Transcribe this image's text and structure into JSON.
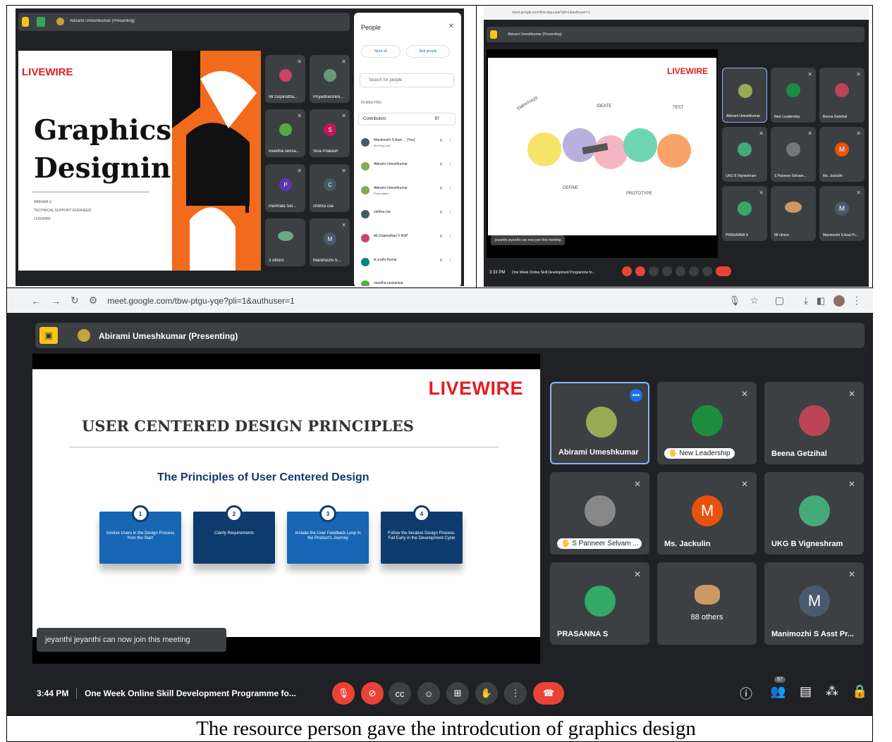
{
  "top_left": {
    "presenter": "Abirami Umeshkumar (Presenting)",
    "slide": {
      "brand": "LIVEWIRE",
      "title_line1": "Graphics",
      "title_line2": "Designing",
      "small1": "ABIRAMI U",
      "small2": "TECHNICAL SUPPORT ENGINEER",
      "small3": "LIVEWIRE"
    },
    "tiles": [
      "Mr.Gopinatha...",
      "Priyadharshini...",
      "nivedha ravisa...",
      "Siva Prakash",
      "Parimala Sel...",
      "chithra cse",
      "3 others",
      "Manimozhi S..."
    ],
    "tile_letters": [
      "S",
      "P",
      "C",
      "M"
    ],
    "people_panel": {
      "title": "People",
      "mute_all": "Mute all",
      "add_people": "Add people",
      "search_placeholder": "Search for people",
      "in_meeting": "IN MEETING",
      "contributors": "Contributors",
      "count": "97",
      "list": [
        {
          "name": "Manimozhi S Asst ... (You)",
          "sub": "Meeting host"
        },
        {
          "name": "Abirami Umeshkumar",
          "sub": ""
        },
        {
          "name": "Abirami Umeshkumar",
          "sub": "Presentation"
        },
        {
          "name": "chithra cse",
          "sub": ""
        },
        {
          "name": "Mr.Gopinathan V ASP",
          "sub": ""
        },
        {
          "name": "A.sruthi Kumar",
          "sub": ""
        },
        {
          "name": "nivedha ravisankar",
          "sub": ""
        }
      ]
    }
  },
  "top_right": {
    "url": "meet.google.com/tbw-ptgu-yqe?pli=1&authuser=1",
    "presenter": "Abirami Umeshkumar (Presenting)",
    "slide": {
      "brand": "LIVEWIRE",
      "labels": [
        "EMPATHIZE",
        "DEFINE",
        "IDEATE",
        "PROTOTYPE",
        "TEST"
      ]
    },
    "notice": "jeyanthi jeyanthi can now join this meeting",
    "tiles": [
      "Abirami Umeshkumar",
      "New Leadership",
      "Beena Getzihal",
      "UKG B Vigneshram",
      "S Panneer Selvam...",
      "Ms. Jackulin",
      "PRASANNA S",
      "88 others",
      "Manimozhi S Asst Pr..."
    ],
    "tile_letters": [
      "M",
      "M"
    ],
    "time": "3:33 PM",
    "meeting": "One Week Online Skill Development Programme fo..."
  },
  "bottom": {
    "url": "meet.google.com/tbw-ptgu-yqe?pli=1&authuser=1",
    "presenter": "Abirami Umeshkumar (Presenting)",
    "slide": {
      "brand": "LIVEWIRE",
      "heading": "USER CENTERED DESIGN PRINCIPLES",
      "subheading": "The Principles of User Centered Design",
      "boxes": [
        {
          "num": "1",
          "text": "Involve Users in the Design Process from the Start",
          "color": "#1766b4"
        },
        {
          "num": "2",
          "text": "Clarify Requirements",
          "color": "#0d3b6e"
        },
        {
          "num": "3",
          "text": "Include the User Feedback Loop in the Product's Journey",
          "color": "#1766b4"
        },
        {
          "num": "4",
          "text": "Follow the Iterative Design Process. Fail Early in the Development Cycle",
          "color": "#0d3b6e"
        }
      ]
    },
    "notice": "jeyanthi jeyanthi can now join this meeting",
    "tiles": [
      {
        "name": "Abirami Umeshkumar"
      },
      {
        "name": "New Leadership"
      },
      {
        "name": "Beena Getzihal"
      },
      {
        "name": "S Panneer Selvam ..."
      },
      {
        "name": "Ms. Jackulin",
        "letter": "M"
      },
      {
        "name": "UKG B Vigneshram"
      },
      {
        "name": "PRASANNA S"
      },
      {
        "name": "88 others"
      },
      {
        "name": "Manimozhi S Asst Pr...",
        "letter": "M"
      }
    ],
    "time": "3:44 PM",
    "meeting": "One Week Online Skill Development Programme fo...",
    "participant_count": "97",
    "colors": {
      "accent": "#f5c518",
      "hangup": "#ea4335",
      "meet_bg": "#202124",
      "tile": "#3c4043",
      "orange_avatar": "#e8520f",
      "slate_avatar": "#4a5a6e"
    }
  },
  "caption": "The resource person gave the introdcution of graphics design"
}
